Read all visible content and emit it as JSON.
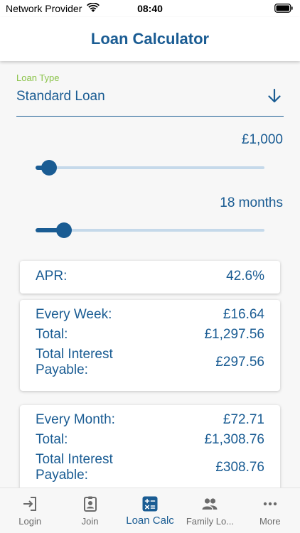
{
  "status_bar": {
    "carrier": "Network Provider",
    "time": "08:40"
  },
  "header": {
    "title": "Loan Calculator"
  },
  "loan_type": {
    "label": "Loan Type",
    "value": "Standard Loan"
  },
  "amount": {
    "label": "£1,000",
    "fraction": 0.06
  },
  "term": {
    "label": "18 months",
    "fraction": 0.125
  },
  "apr": {
    "label": "APR:",
    "value": "42.6%"
  },
  "weekly": {
    "every_label": "Every Week:",
    "every_value": "£16.64",
    "total_label": "Total:",
    "total_value": "£1,297.56",
    "interest_label": "Total Interest Payable:",
    "interest_value": "£297.56"
  },
  "monthly": {
    "every_label": "Every Month:",
    "every_value": "£72.71",
    "total_label": "Total:",
    "total_value": "£1,308.76",
    "interest_label": "Total Interest Payable:",
    "interest_value": "£308.76"
  },
  "tabs": [
    {
      "label": "Login",
      "icon": "login-icon"
    },
    {
      "label": "Join",
      "icon": "badge-icon"
    },
    {
      "label": "Loan Calc",
      "icon": "calculator-icon",
      "active": true
    },
    {
      "label": "Family Lo...",
      "icon": "people-icon"
    },
    {
      "label": "More",
      "icon": "more-icon"
    }
  ],
  "colors": {
    "accent": "#1a5c93",
    "track": "#c5d9ea",
    "label_green": "#8bc34a",
    "tab_inactive": "#6b6b6b"
  }
}
